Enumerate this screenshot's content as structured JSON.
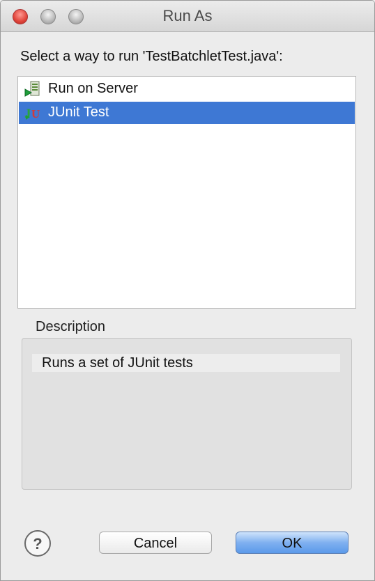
{
  "window": {
    "title": "Run As"
  },
  "prompt": "Select a way to run 'TestBatchletTest.java':",
  "list": {
    "items": [
      {
        "label": "Run on Server",
        "icon": "run-on-server-icon",
        "selected": false
      },
      {
        "label": "JUnit Test",
        "icon": "junit-icon",
        "selected": true
      }
    ]
  },
  "description": {
    "title": "Description",
    "text": "Runs a set of JUnit tests"
  },
  "buttons": {
    "cancel": "Cancel",
    "ok": "OK"
  },
  "colors": {
    "selection": "#3e78d4",
    "ok_button": "#7fb0f0"
  }
}
